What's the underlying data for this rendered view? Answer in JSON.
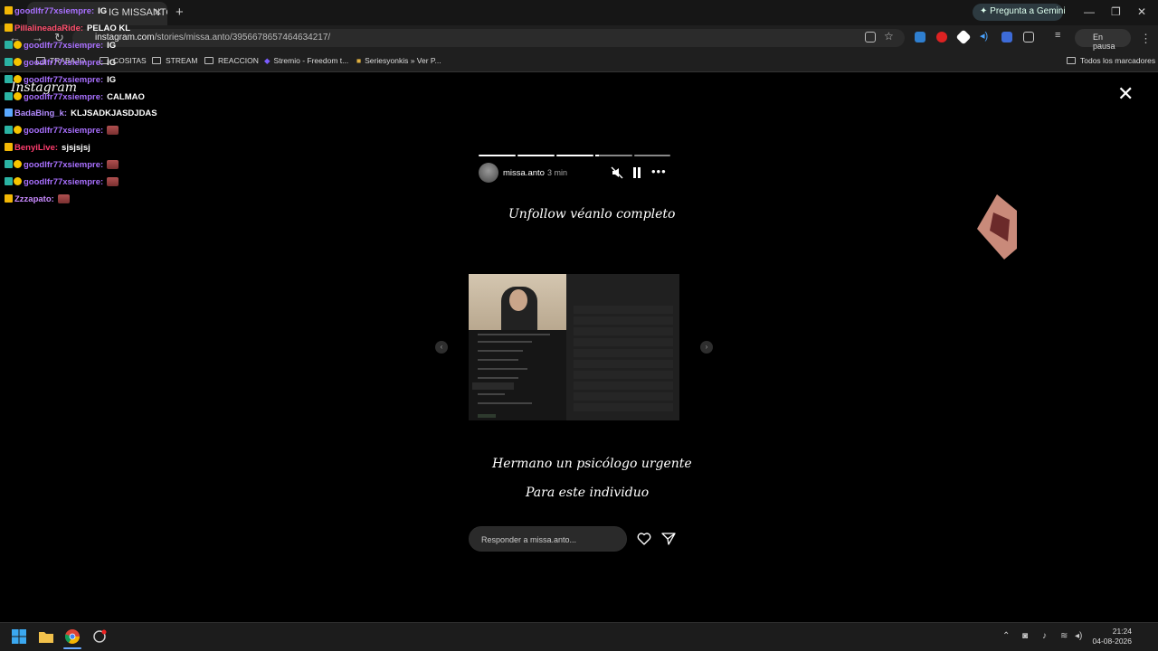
{
  "browser": {
    "tab_title": "IG MISSANTO",
    "new_tab": "+",
    "gemini_label": "Pregunta a Gemini",
    "url_host": "instagram.com",
    "url_path": "/stories/missa.anto/3956678657464634217/",
    "profile_status": "En pausa",
    "bookmarks": [
      {
        "label": "TRABAJO"
      },
      {
        "label": "COSITAS"
      },
      {
        "label": "STREAM"
      },
      {
        "label": "REACCION"
      },
      {
        "label": "Stremio - Freedom t..."
      },
      {
        "label": "Seriesyonkis » Ver P..."
      }
    ],
    "all_bookmarks": "Todos los marcadores"
  },
  "page": {
    "logo": "Instagram",
    "close": "✕"
  },
  "story": {
    "username": "missa.anto",
    "time": "3 min",
    "segments": [
      1,
      1,
      1,
      0.1,
      0
    ],
    "text_top": "Unfollow véanlo completo",
    "text_bottom_1": "Hermano un psicólogo urgente",
    "text_bottom_2": "Para este individuo",
    "reply_placeholder": "Responder a missa.anto...",
    "prev_arrow": "‹",
    "next_arrow": "›"
  },
  "chat": [
    {
      "user": "goodlfr77xsiempre:",
      "color": "#a970ff",
      "text": "IG",
      "badge": "crown"
    },
    {
      "user": "PillalineadaRide:",
      "color": "#ff4f6d",
      "text": "PELAO KL",
      "badge": "crown"
    },
    {
      "user": "goodlfr77xsiempre:",
      "color": "#a970ff",
      "text": "IG",
      "badge": "sub"
    },
    {
      "user": "goodlfr77xsiempre:",
      "color": "#a970ff",
      "text": "IG",
      "badge": "sub"
    },
    {
      "user": "goodlfr77xsiempre:",
      "color": "#a970ff",
      "text": "IG",
      "badge": "sub"
    },
    {
      "user": "goodlfr77xsiempre:",
      "color": "#a970ff",
      "text": "CALMAO",
      "badge": "sub"
    },
    {
      "user": "BadaBing_k:",
      "color": "#b38bff",
      "text": "KLJSADKJASDJDAS",
      "badge": "sword"
    },
    {
      "user": "goodlfr77xsiempre:",
      "color": "#a970ff",
      "text": "",
      "badge": "sub",
      "emote": true
    },
    {
      "user": "BenyiLive:",
      "color": "#ff3d6e",
      "text": "sjsjsjsj",
      "badge": "crown"
    },
    {
      "user": "goodlfr77xsiempre:",
      "color": "#a970ff",
      "text": "",
      "badge": "sub",
      "emote": true
    },
    {
      "user": "goodlfr77xsiempre:",
      "color": "#a970ff",
      "text": "",
      "badge": "sub",
      "emote": true
    },
    {
      "user": "Zzzapato:",
      "color": "#c98aff",
      "text": "",
      "badge": "crown",
      "emote": true
    }
  ],
  "taskbar": {
    "time": "21:24",
    "date": "04-08-2026"
  },
  "colors": {
    "chrome_bg": "#1f1f1f",
    "page_bg": "#000000",
    "accent_purple": "#a970ff"
  }
}
